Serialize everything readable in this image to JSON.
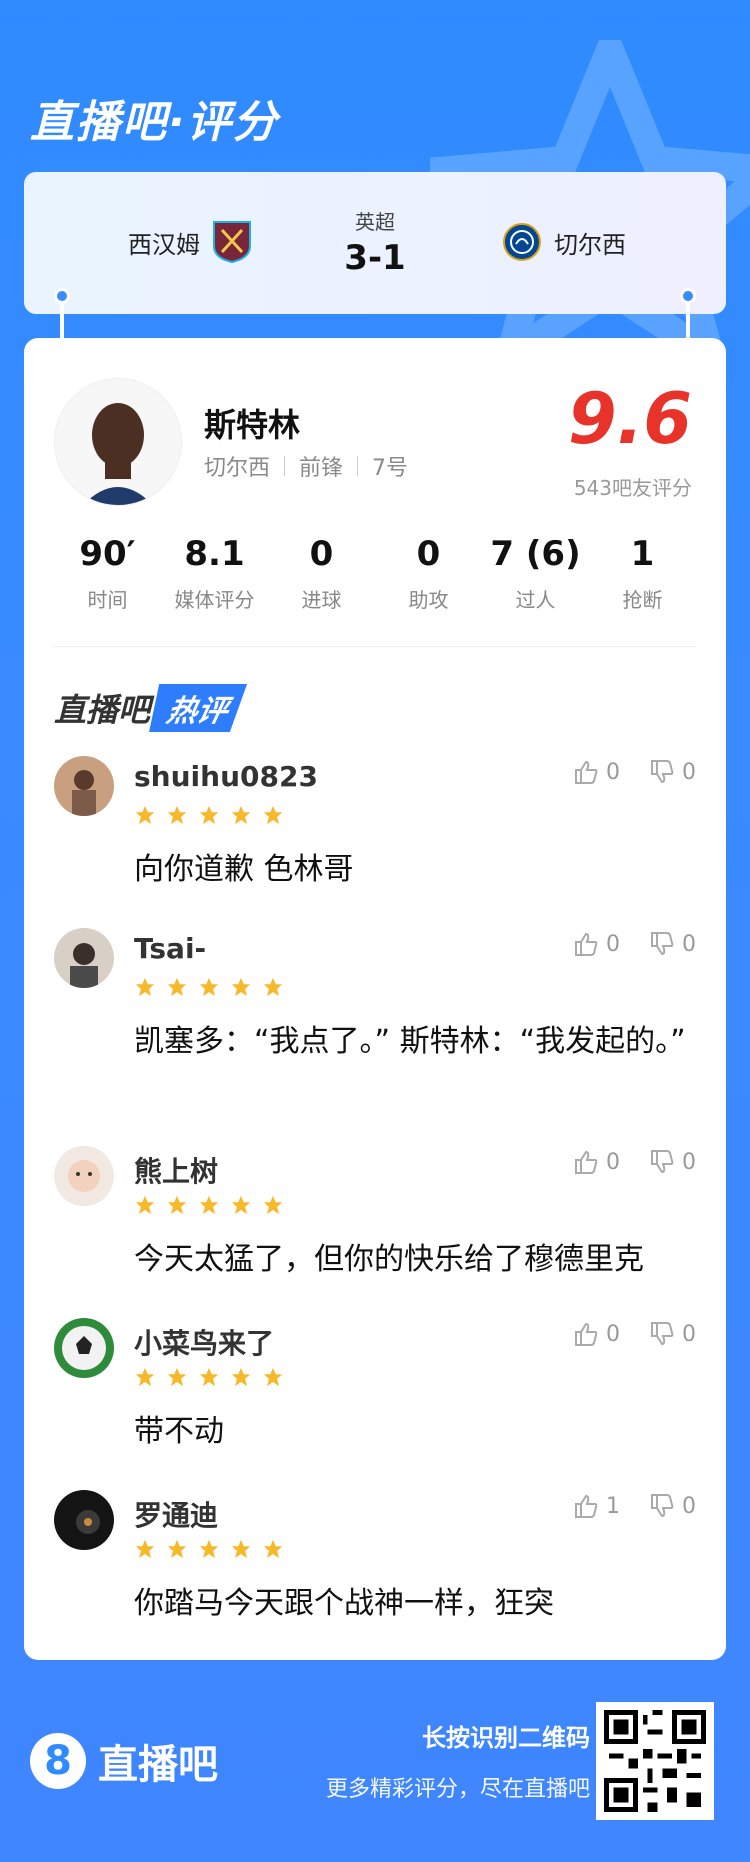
{
  "brand": {
    "title": "直播吧·评分"
  },
  "match": {
    "home": "西汉姆",
    "away": "切尔西",
    "competition": "英超",
    "score": "3-1"
  },
  "player": {
    "name": "斯特林",
    "team": "切尔西",
    "position": "前锋",
    "number": "7号",
    "rating": "9.6",
    "rating_count": "543吧友评分"
  },
  "stats": [
    {
      "value": "90′",
      "label": "时间"
    },
    {
      "value": "8.1",
      "label": "媒体评分"
    },
    {
      "value": "0",
      "label": "进球"
    },
    {
      "value": "0",
      "label": "助攻"
    },
    {
      "value": "7 (6)",
      "label": "过人"
    },
    {
      "value": "1",
      "label": "抢断"
    }
  ],
  "hot_comments_title": {
    "part1": "直播吧",
    "part2": "热评"
  },
  "comments": [
    {
      "user": "shuihu0823",
      "text": "向你道歉 色林哥",
      "likes": "0",
      "dislikes": "0",
      "stars": 5
    },
    {
      "user": "Tsai-",
      "text": "凯塞多：“我点了。” 斯特林：“我发起的。”",
      "likes": "0",
      "dislikes": "0",
      "stars": 5
    },
    {
      "user": "熊上树",
      "text": "今天太猛了，但你的快乐给了穆德里克",
      "likes": "0",
      "dislikes": "0",
      "stars": 5
    },
    {
      "user": "小菜鸟来了",
      "text": "带不动",
      "likes": "0",
      "dislikes": "0",
      "stars": 5
    },
    {
      "user": "罗通迪",
      "text": "你踏马今天跟个战神一样，狂突",
      "likes": "1",
      "dislikes": "0",
      "stars": 5
    }
  ],
  "footer": {
    "logo_text": "直播吧",
    "logo_digit": "8",
    "cta_main": "长按识别二维码",
    "cta_sub": "更多精彩评分，尽在直播吧"
  },
  "colors": {
    "accent": "#2f8bff",
    "rating": "#e8332b",
    "star": "#f6b92b"
  }
}
